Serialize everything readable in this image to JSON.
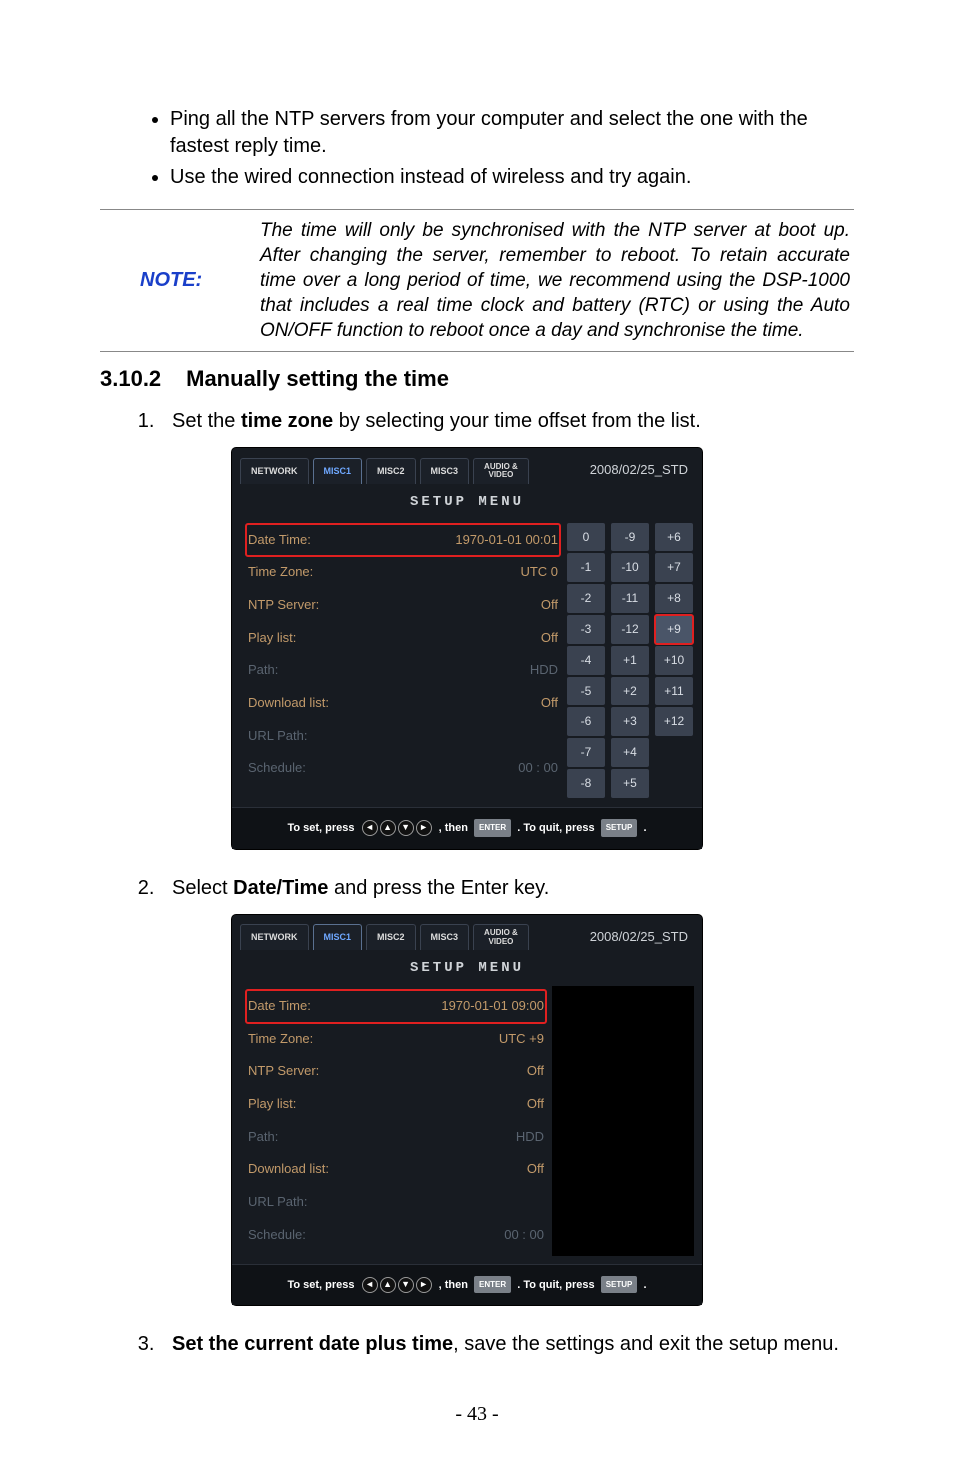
{
  "bullets": [
    "Ping all the NTP servers from your computer and select the one with the fastest reply time.",
    "Use the wired connection instead of wireless and try again."
  ],
  "note": {
    "label": "NOTE:",
    "text": "The time will only be synchronised with the NTP server at boot up. After changing the server, remember to reboot. To retain accurate time over a long period of time, we recommend using the DSP-1000 that includes a real time clock and battery (RTC) or using the Auto ON/OFF function to reboot once a day and synchronise the time."
  },
  "heading": {
    "num": "3.10.2",
    "title": "Manually setting the time"
  },
  "steps": {
    "s1_pre": "Set the ",
    "s1_b": "time zone",
    "s1_post": " by selecting your time offset from the list.",
    "s2_pre": "Select ",
    "s2_b": "Date/Time",
    "s2_post": " and press the Enter key.",
    "s3_b": "Set the current date plus time",
    "s3_post": ", save the settings and exit the setup menu."
  },
  "shot_common": {
    "tabs": {
      "network": "NETWORK",
      "misc1": "MISC1",
      "misc2": "MISC2",
      "misc3": "MISC3",
      "av1": "AUDIO &",
      "av2": "VIDEO"
    },
    "timestamp": "2008/02/25_STD",
    "menu_title": "SETUP  MENU",
    "labels": {
      "datetime": "Date Time:",
      "timezone": "Time Zone:",
      "ntp": "NTP Server:",
      "play": "Play list:",
      "path": "Path:",
      "download": "Download list:",
      "urlpath": "URL Path:",
      "schedule": "Schedule:"
    },
    "help": {
      "pre": "To set, press",
      "mid": ", then",
      "enter": "ENTER",
      "mid2": ". To quit, press",
      "setup": "SETUP",
      "end": "."
    }
  },
  "shot1": {
    "values": {
      "datetime": "1970-01-01 00:01",
      "timezone": "UTC 0",
      "ntp": "Off",
      "play": "Off",
      "path": "HDD",
      "download": "Off",
      "urlpath": "",
      "schedule": "00 : 00"
    },
    "grid": {
      "c1": [
        "0",
        "-1",
        "-2",
        "-3",
        "-4",
        "-5",
        "-6",
        "-7",
        "-8"
      ],
      "c2": [
        "-9",
        "-10",
        "-11",
        "-12",
        "+1",
        "+2",
        "+3",
        "+4",
        "+5"
      ],
      "c3": [
        "+6",
        "+7",
        "+8",
        "+9",
        "+10",
        "+11",
        "+12"
      ]
    },
    "selected_cell": "+9"
  },
  "shot2": {
    "values": {
      "datetime": "1970-01-01 09:00",
      "timezone": "UTC +9",
      "ntp": "Off",
      "play": "Off",
      "path": "HDD",
      "download": "Off",
      "urlpath": "",
      "schedule": "00 : 00"
    }
  },
  "page_number": "- 43 -"
}
